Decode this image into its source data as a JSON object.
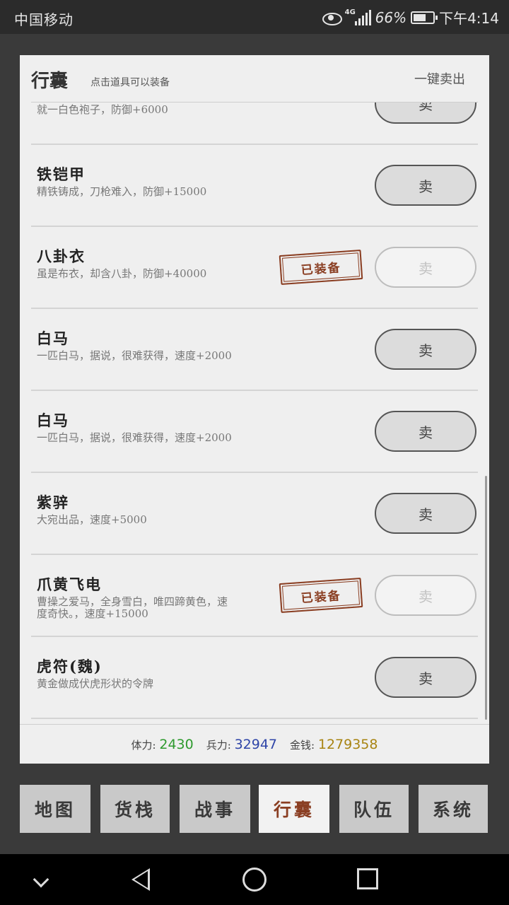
{
  "status_bar": {
    "carrier": "中国移动",
    "network": "4G",
    "battery_percent": "66%",
    "battery_level": 0.66,
    "time": "下午4:14"
  },
  "panel": {
    "title": "行囊",
    "hint": "点击道具可以装备",
    "sell_all_label": "一键卖出"
  },
  "items": [
    {
      "name": "",
      "desc": "就一白色袍子，防御+6000",
      "equipped": false,
      "sell_label": "卖"
    },
    {
      "name": "铁铠甲",
      "desc": "精铁铸成，刀枪难入，防御+15000",
      "equipped": false,
      "sell_label": "卖"
    },
    {
      "name": "八卦衣",
      "desc": "虽是布衣，却含八卦，防御+40000",
      "equipped": true,
      "sell_label": "卖"
    },
    {
      "name": "白马",
      "desc": "一匹白马，据说，很难获得，速度+2000",
      "equipped": false,
      "sell_label": "卖"
    },
    {
      "name": "白马",
      "desc": "一匹白马，据说，很难获得，速度+2000",
      "equipped": false,
      "sell_label": "卖"
    },
    {
      "name": "紫骍",
      "desc": "大宛出品，速度+5000",
      "equipped": false,
      "sell_label": "卖"
    },
    {
      "name": "爪黄飞电",
      "desc": "曹操之爱马，全身雪白，唯四蹄黄色，速度奇快。，速度+15000",
      "equipped": true,
      "sell_label": "卖"
    },
    {
      "name": "虎符(魏)",
      "desc": "黄金做成伏虎形状的令牌",
      "equipped": false,
      "sell_label": "卖"
    }
  ],
  "equipped_stamp": "已装备",
  "stats": {
    "stamina_label": "体力:",
    "stamina": "2430",
    "troops_label": "兵力:",
    "troops": "32947",
    "money_label": "金钱:",
    "money": "1279358",
    "colors": {
      "stamina": "#2e9a2e",
      "troops": "#2f45a8",
      "money": "#a88412"
    }
  },
  "tabs": [
    {
      "label": "地图",
      "active": false
    },
    {
      "label": "货栈",
      "active": false
    },
    {
      "label": "战事",
      "active": false
    },
    {
      "label": "行囊",
      "active": true
    },
    {
      "label": "队伍",
      "active": false
    },
    {
      "label": "系统",
      "active": false
    }
  ],
  "nav_icons": [
    "chevron-down-icon",
    "back-icon",
    "home-icon",
    "recent-apps-icon"
  ]
}
